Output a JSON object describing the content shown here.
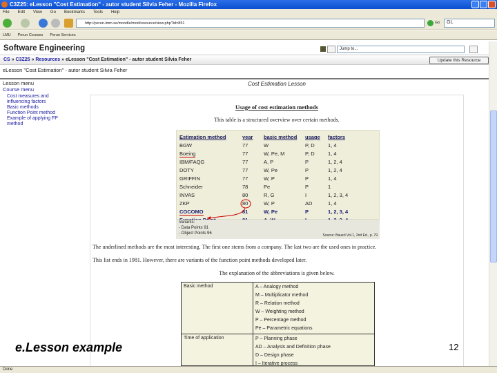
{
  "window": {
    "title": "C3Z25: eLesson \"Cost Estimation\" - autor student Silvia Feher - Mozilla Firefox"
  },
  "menu": [
    "File",
    "Edit",
    "View",
    "Go",
    "Bookmarks",
    "Tools",
    "Help"
  ],
  "toolbar": {
    "url": "http://perun.imm.se/moodle/mod/resource/view.php?id=851",
    "go_label": "Go",
    "search_value": "GL"
  },
  "bookmarks": [
    "LMU",
    "Perun Courses",
    "Perun Services"
  ],
  "site": {
    "title": "Software Engineering",
    "jump_placeholder": "Jump to...",
    "breadcrumb": [
      "CS",
      "C3Z25",
      "Resources"
    ],
    "breadcrumb_current": "eLesson \"Cost Estimation\" - autor student Silvia Feher",
    "update_button": "Update this Resource",
    "subtitle": "eLesson \"Cost Estimation\" - autor student Silvia Feher"
  },
  "lesson_menu": {
    "title": "Lesson menu",
    "course_menu": "Course menu",
    "items": [
      "Cost measures and influencing factors",
      "Basic methods",
      "Function Point method",
      "Example of applying FP method"
    ]
  },
  "lesson": {
    "title": "Cost Estimation Lesson",
    "heading": "Usage of cost estimation methods",
    "intro": "This table is a structured overview over certain methods.",
    "table": {
      "headers": [
        "Estimation method",
        "year",
        "basic method",
        "usage",
        "factors"
      ],
      "rows": [
        [
          "BGW",
          "77",
          "W",
          "P, D",
          "1, 4"
        ],
        [
          "Boeing",
          "77",
          "W, Pe, M",
          "P, D",
          "1, 4"
        ],
        [
          "IBM/FAQG",
          "77",
          "A, P",
          "P",
          "1, 2, 4"
        ],
        [
          "DOTY",
          "77",
          "W, Pe",
          "P",
          "1, 2, 4"
        ],
        [
          "GRIFFIN",
          "77",
          "W, P",
          "P",
          "1, 4"
        ],
        [
          "Schneider",
          "78",
          "Pe",
          "P",
          "1"
        ],
        [
          "INVAS",
          "80",
          "R, G",
          "I",
          "1, 2, 3, 4"
        ],
        [
          "ZKP",
          "80",
          "W, P",
          "AD",
          "1, 4"
        ],
        [
          "COCOMO",
          "81",
          "W, Pe",
          "P",
          "1, 2, 3, 4"
        ],
        [
          "Function Point",
          "81",
          "A, W",
          "I",
          "1, 2, 3, 4"
        ]
      ]
    },
    "variants_title": "Variants:",
    "variants": [
      "- Data Points 91",
      "- Object Points 96"
    ],
    "source": "Source: Bauerl Vol.1, 2nd Ed., p. 79",
    "para1": "The underlined methods are the most interesting. The first one stems from a company. The last two are the used ones in practice.",
    "para2": "This list ends in 1981. However, there are variants of the function point methods developed later.",
    "para3": "The explanation of the abbreviations is given below.",
    "abbr": [
      {
        "label": "Basic method",
        "items": [
          "A – Analogy method",
          "M – Multiplicator method",
          "R – Relation method",
          "W – Weighting method",
          "P – Percentage method",
          "Pe – Parametric equations"
        ]
      },
      {
        "label": "Time of application",
        "items": [
          "P – Planning phase",
          "AD – Analysis and Definition phase",
          "D – Design phase",
          "I – Iterative process"
        ]
      }
    ]
  },
  "slide": {
    "label": "e.Lesson example",
    "page_number": "12"
  },
  "status": "Done"
}
